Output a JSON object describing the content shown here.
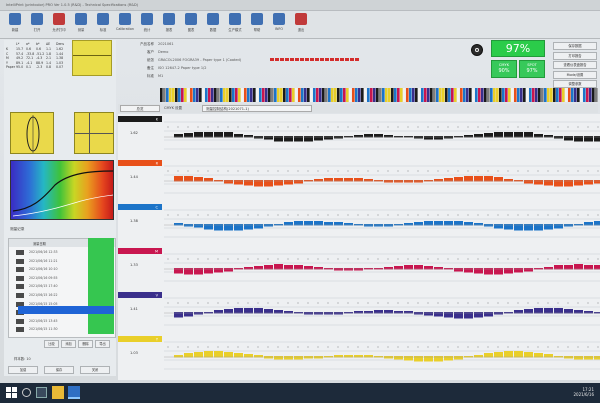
{
  "window": {
    "title": "IntelliPrint (printcolor) PRO Ver 1.0.5 (R&D) - Technical Specifications (R&D)"
  },
  "toolbar": {
    "items": [
      {
        "label": "新建",
        "color": "#3f6fb2",
        "icon": "file-icon"
      },
      {
        "label": "打开",
        "color": "#3f6fb2",
        "icon": "folder-icon"
      },
      {
        "label": "允许打印",
        "color": "#c03a3a",
        "icon": "print-icon"
      },
      {
        "label": "测量",
        "color": "#3f6fb2",
        "icon": "measure-icon"
      },
      {
        "label": "标准",
        "color": "#3f6fb2",
        "icon": "standard-icon"
      },
      {
        "label": "Calibration",
        "color": "#3f6fb2",
        "icon": "calibrate-icon"
      },
      {
        "label": "统计",
        "color": "#3f6fb2",
        "icon": "chart-icon"
      },
      {
        "label": "报表",
        "color": "#3f6fb2",
        "icon": "report-icon"
      },
      {
        "label": "图表",
        "color": "#3f6fb2",
        "icon": "graph-icon"
      },
      {
        "label": "数据",
        "color": "#3f6fb2",
        "icon": "data-icon"
      },
      {
        "label": "生产模式",
        "color": "#3f6fb2",
        "icon": "production-icon"
      },
      {
        "label": "帮助",
        "color": "#3f6fb2",
        "icon": "help-icon"
      },
      {
        "label": "INFO",
        "color": "#3f6fb2",
        "icon": "info-icon"
      },
      {
        "label": "退出",
        "color": "#c03a3a",
        "icon": "exit-icon"
      }
    ]
  },
  "info": {
    "rows": [
      {
        "key": "产品名称",
        "value": "2021061"
      },
      {
        "key": "客户",
        "value": "Demo"
      },
      {
        "key": "纸张",
        "value": "GRACOL2006 FOGRA39 - Paper type 1 (Coated)"
      },
      {
        "key": "备注",
        "value": "ISO 12647-2 Paper type 1/2"
      },
      {
        "key": "标准",
        "value": "M1"
      }
    ]
  },
  "score": {
    "overall": "97%",
    "sub": [
      {
        "title": "CMYK",
        "value": "90%"
      },
      {
        "title": "SPOT",
        "value": "97%"
      }
    ]
  },
  "right_buttons": [
    "保存数据",
    "打印报告",
    "查看仪表盘报告",
    "Mode/设置",
    "调整参数"
  ],
  "tabs": {
    "left": "总览",
    "right": "测量控制结构(2021071-1)",
    "extra": "CMYK 设置"
  },
  "left": {
    "table_header": [
      "",
      "L*",
      "a*",
      "b*",
      "ΔE",
      "Dens"
    ],
    "table_rows": [
      [
        "K",
        "15.7",
        "0.6",
        "0.6",
        "1.1",
        "1.62"
      ],
      [
        "C",
        "57.4",
        "-33.8",
        "-51.2",
        "1.8",
        "1.44"
      ],
      [
        "M",
        "49.2",
        "72.1",
        "-4.3",
        "2.1",
        "1.38"
      ],
      [
        "Y",
        "89.1",
        "-4.1",
        "88.9",
        "1.4",
        "1.03"
      ],
      [
        "Paper",
        "95.0",
        "0.1",
        "-2.3",
        "0.8",
        "0.07"
      ]
    ],
    "history_title": "测量记录",
    "history_header": [
      "",
      "测量日期",
      "结果"
    ],
    "history": [
      {
        "date": "2021/06/16 12:33",
        "status": "97%"
      },
      {
        "date": "2021/06/16 11:21",
        "status": "96%"
      },
      {
        "date": "2021/06/16 10:10",
        "status": "96%"
      },
      {
        "date": "2021/06/16 09:55",
        "status": "95%"
      },
      {
        "date": "2021/06/15 17:40",
        "status": "97%"
      },
      {
        "date": "2021/06/15 16:22",
        "status": "96%"
      },
      {
        "date": "2021/06/15 15:05",
        "status": "94%"
      },
      {
        "date": "2021/06/15 14:11",
        "status": "95%"
      },
      {
        "date": "2021/06/15 13:45",
        "status": "96%"
      },
      {
        "date": "2021/06/15 11:30",
        "status": "97%"
      }
    ],
    "buttons": [
      "比较",
      "添加",
      "删除",
      "导出"
    ],
    "sample_count": "样本数: 10",
    "footer_buttons": [
      "加载",
      "保存",
      "关闭"
    ]
  },
  "channels": [
    {
      "name": "K",
      "color": "#1b1b1b",
      "density": "1.62"
    },
    {
      "name": "R",
      "color": "#e8501a",
      "density": "1.44"
    },
    {
      "name": "C",
      "color": "#1c74c8",
      "density": "1.38"
    },
    {
      "name": "M",
      "color": "#c8164f",
      "density": "1.33"
    },
    {
      "name": "V",
      "color": "#3a2f8c",
      "density": "1.41"
    },
    {
      "name": "Y",
      "color": "#e9cf2a",
      "density": "1.03"
    }
  ],
  "taskbar": {
    "time": "17:21",
    "date": "2021/6/16"
  }
}
